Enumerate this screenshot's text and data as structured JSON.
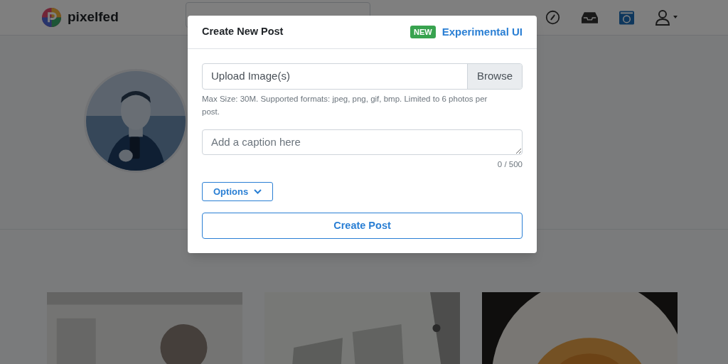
{
  "navbar": {
    "brand": "pixelfed"
  },
  "modal": {
    "title": "Create New Post",
    "badge": "NEW",
    "link": "Experimental UI",
    "upload": {
      "label": "Upload Image(s)",
      "button": "Browse"
    },
    "help": "Max Size: 30M. Supported formats: jpeg, png, gif, bmp. Limited to 6 photos per post.",
    "caption": {
      "placeholder": "Add a caption here"
    },
    "counter": "0 / 500",
    "options_button": "Options",
    "submit": "Create Post"
  }
}
